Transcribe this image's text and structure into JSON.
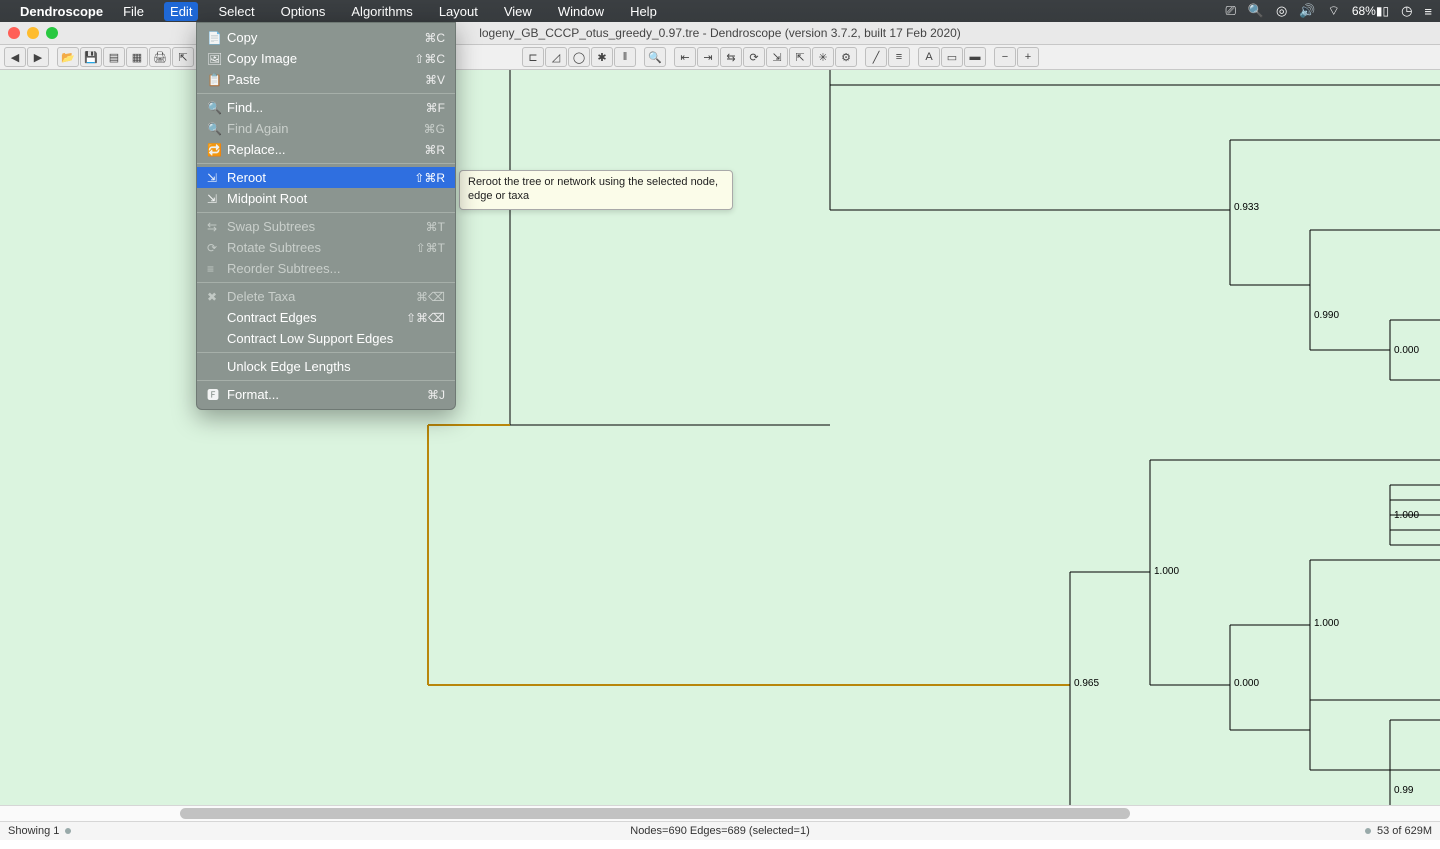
{
  "menubar": {
    "app": "Dendroscope",
    "items": [
      "File",
      "Edit",
      "Select",
      "Options",
      "Algorithms",
      "Layout",
      "View",
      "Window",
      "Help"
    ],
    "open_index": 1,
    "battery_pct": "68%"
  },
  "window": {
    "title": "logeny_GB_CCCP_otus_greedy_0.97.tre - Dendroscope (version 3.7.2, built 17 Feb 2020)"
  },
  "edit_menu": {
    "items": [
      {
        "label": "Copy",
        "shortcut": "⌘C",
        "enabled": true,
        "icon": "📄"
      },
      {
        "label": "Copy Image",
        "shortcut": "⇧⌘C",
        "enabled": true,
        "icon": "🖼"
      },
      {
        "label": "Paste",
        "shortcut": "⌘V",
        "enabled": true,
        "icon": "📋"
      },
      {
        "sep": true
      },
      {
        "label": "Find...",
        "shortcut": "⌘F",
        "enabled": true,
        "icon": "🔍"
      },
      {
        "label": "Find Again",
        "shortcut": "⌘G",
        "enabled": false,
        "icon": "🔍"
      },
      {
        "label": "Replace...",
        "shortcut": "⌘R",
        "enabled": true,
        "icon": "🔁"
      },
      {
        "sep": true
      },
      {
        "label": "Reroot",
        "shortcut": "⇧⌘R",
        "enabled": true,
        "icon": "⇲",
        "highlight": true
      },
      {
        "label": "Midpoint Root",
        "shortcut": "",
        "enabled": true,
        "icon": "⇲"
      },
      {
        "sep": true
      },
      {
        "label": "Swap Subtrees",
        "shortcut": "⌘T",
        "enabled": false,
        "icon": "⇆"
      },
      {
        "label": "Rotate Subtrees",
        "shortcut": "⇧⌘T",
        "enabled": false,
        "icon": "⟳"
      },
      {
        "label": "Reorder Subtrees...",
        "shortcut": "",
        "enabled": false,
        "icon": "≡"
      },
      {
        "sep": true
      },
      {
        "label": "Delete Taxa",
        "shortcut": "⌘⌫",
        "enabled": false,
        "icon": "✖"
      },
      {
        "label": "Contract Edges",
        "shortcut": "⇧⌘⌫",
        "enabled": true,
        "icon": ""
      },
      {
        "label": "Contract Low Support Edges",
        "shortcut": "",
        "enabled": true,
        "icon": ""
      },
      {
        "sep": true
      },
      {
        "label": "Unlock Edge Lengths",
        "shortcut": "",
        "enabled": true,
        "icon": ""
      },
      {
        "sep": true
      },
      {
        "label": "Format...",
        "shortcut": "⌘J",
        "enabled": true,
        "icon": "🅵"
      }
    ],
    "tooltip": "Reroot the tree or network using the selected node, edge or taxa"
  },
  "tree_labels": {
    "l1": "0.933",
    "l2": "0.990",
    "l3": "0.000",
    "l4": "1.000",
    "l4b": "1.000",
    "l5": "1.000",
    "l6": "0.000",
    "l7": "0.965",
    "l8": "0.99"
  },
  "statusbar": {
    "left": "Showing 1",
    "center": "Nodes=690 Edges=689 (selected=1)",
    "right": "53 of 629M"
  }
}
